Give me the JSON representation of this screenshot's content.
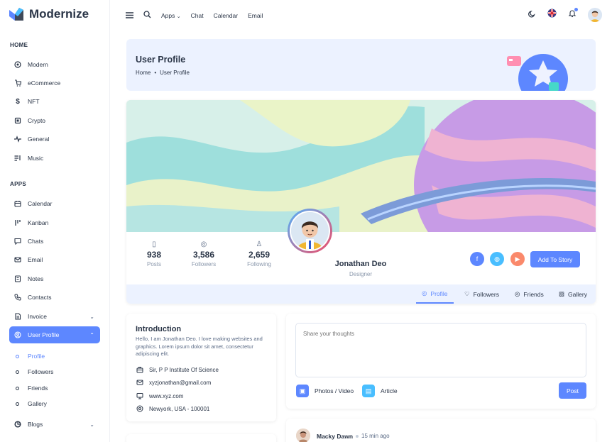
{
  "app": {
    "name": "Modernize",
    "brand_color": "#5d87ff"
  },
  "sidebar": {
    "home_title": "HOME",
    "home_items": [
      {
        "label": "Modern",
        "icon": "aperture-icon"
      },
      {
        "label": "eCommerce",
        "icon": "shopping-cart-icon"
      },
      {
        "label": "NFT",
        "icon": "currency-dollar-icon"
      },
      {
        "label": "Crypto",
        "icon": "cpu-icon"
      },
      {
        "label": "General",
        "icon": "activity-heartbeat-icon"
      },
      {
        "label": "Music",
        "icon": "playlist-icon"
      }
    ],
    "apps_title": "APPS",
    "apps_items": [
      {
        "label": "Calendar",
        "icon": "calendar-icon"
      },
      {
        "label": "Kanban",
        "icon": "kanban-icon"
      },
      {
        "label": "Chats",
        "icon": "message-icon"
      },
      {
        "label": "Email",
        "icon": "mail-icon"
      },
      {
        "label": "Notes",
        "icon": "notes-icon"
      },
      {
        "label": "Contacts",
        "icon": "phone-icon"
      },
      {
        "label": "Invoice",
        "icon": "file-text-icon"
      },
      {
        "label": "User Profile",
        "icon": "user-circle-icon"
      }
    ],
    "profile_sub": [
      "Profile",
      "Followers",
      "Friends",
      "Gallery"
    ],
    "blogs": "Blogs"
  },
  "topbar": {
    "links": [
      "Apps",
      "Chat",
      "Calendar",
      "Email"
    ]
  },
  "breadcrumb": {
    "title": "User Profile",
    "home": "Home",
    "current": "User Profile"
  },
  "profile": {
    "stats": [
      {
        "value": "938",
        "label": "Posts"
      },
      {
        "value": "3,586",
        "label": "Followers"
      },
      {
        "value": "2,659",
        "label": "Following"
      }
    ],
    "name": "Jonathan Deo",
    "role": "Designer",
    "story_button": "Add To Story",
    "tabs": [
      "Profile",
      "Followers",
      "Friends",
      "Gallery"
    ]
  },
  "intro": {
    "title": "Introduction",
    "text": "Hello, I am Jonathan Deo. I love making websites and graphics. Lorem ipsum dolor sit amet, consectetur adipiscing elit.",
    "school": "Sir, P P Institute Of Science",
    "email": "xyzjonathan@gmail.com",
    "website": "www.xyz.com",
    "location": "Newyork, USA - 100001"
  },
  "composer": {
    "placeholder": "Share your thoughts",
    "photos": "Photos / Video",
    "article": "Article",
    "post": "Post"
  },
  "feed": {
    "name": "Macky Dawn",
    "time": "15 min ago"
  }
}
